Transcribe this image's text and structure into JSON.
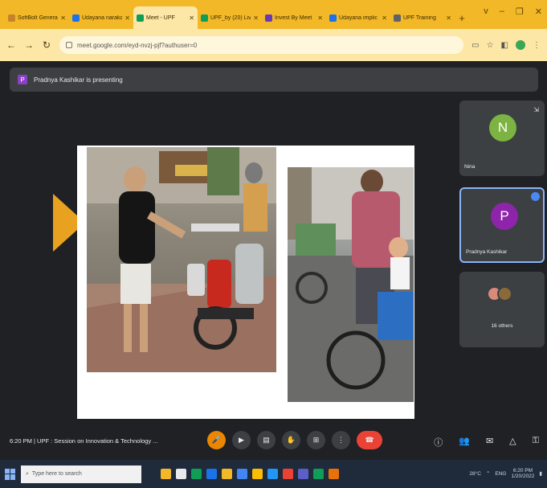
{
  "browser": {
    "tabs": [
      {
        "title": "SoftBolt General",
        "color": "#c7832a",
        "active": false
      },
      {
        "title": "Udayana naraka",
        "color": "#1a73e8",
        "active": false
      },
      {
        "title": "Meet - UPF",
        "color": "#0f9d58",
        "active": true
      },
      {
        "title": "UPF_by (20) Live",
        "color": "#0f9d58",
        "active": false
      },
      {
        "title": "Invest By Meet",
        "color": "#673ab7",
        "active": false
      },
      {
        "title": "Udayana implic",
        "color": "#1a73e8",
        "active": false
      },
      {
        "title": "UPF Training",
        "color": "#5f6368",
        "active": false
      }
    ],
    "new_tab": "+",
    "window_controls": [
      "v",
      "–",
      "❐",
      "✕"
    ],
    "url": "meet.google.com/eyd-nvzj-pjf?authuser=0",
    "nav": {
      "back": "←",
      "forward": "→",
      "reload": "↻"
    }
  },
  "meet": {
    "presenting_text": "Pradnya Kashikar is presenting",
    "presenter_initial": "P",
    "participants": [
      {
        "initial": "N",
        "name": "Nina",
        "color": "#7cb342"
      },
      {
        "initial": "P",
        "name": "Pradnya Kashikar",
        "color": "#8e24aa"
      }
    ],
    "others_label": "16 others",
    "time": "6:20 PM",
    "meeting_title": "UPF : Session on Innovation & Technology ...",
    "meeting_info": "6:20 PM  |  UPF : Session on Innovation & Technology ..."
  },
  "taskbar": {
    "search_placeholder": "Type here to search",
    "weather": "28°C",
    "time": "6:20 PM",
    "date": "1/20/2022",
    "lang": "ENG"
  },
  "colors": {
    "tab_strip": "#f2b827",
    "accent": "#e8a21f",
    "end_call": "#ea4335"
  }
}
